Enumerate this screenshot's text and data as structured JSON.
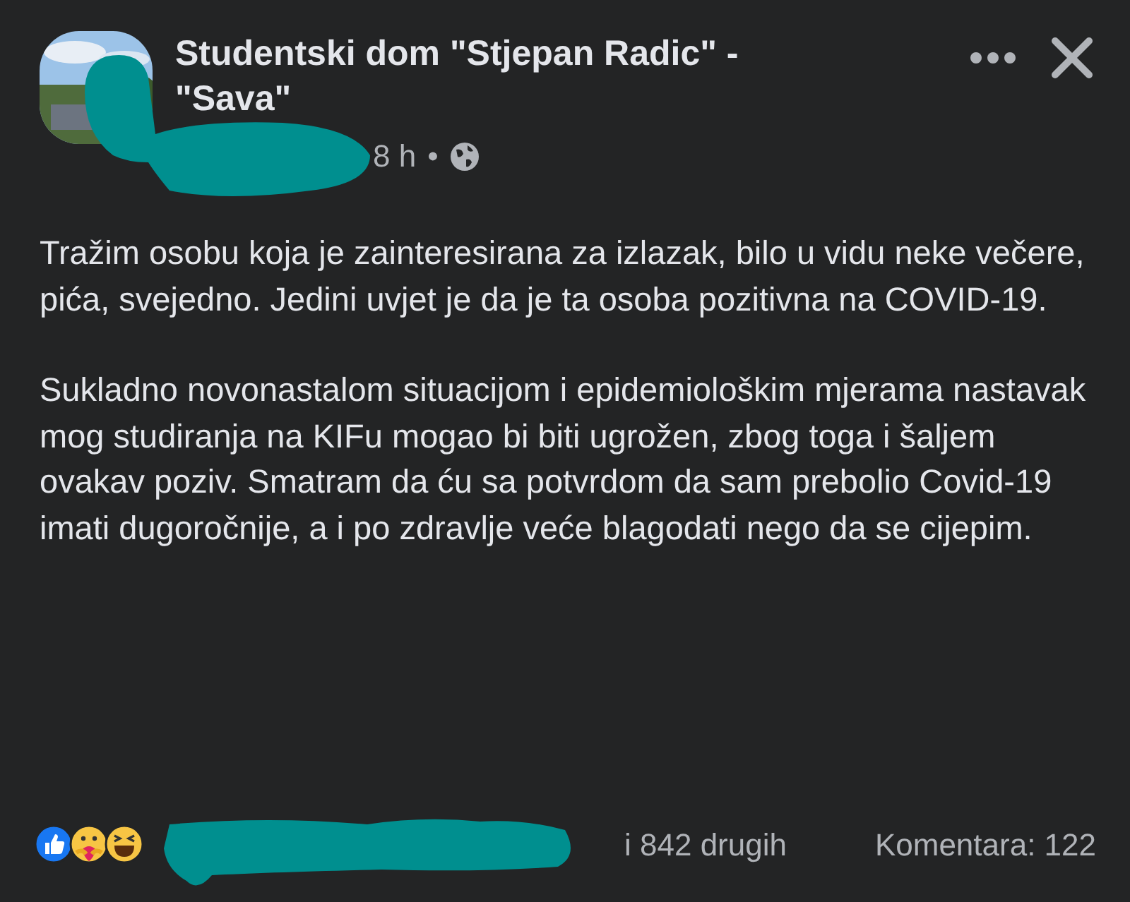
{
  "post": {
    "page_name": "Studentski dom \"Stjepan Radic\" - \"Sava\"",
    "time": "8 h",
    "separator": "•",
    "paragraphs": [
      "Tražim osobu koja je zainteresirana za izlazak, bilo u vidu neke večere, pića, svejedno. Jedini uvjet je da je ta osoba pozitivna na COVID-19.",
      "Sukladno novonastalom situacijom i epidemiološkim mjerama nastavak mog studiranja na KIFu mogao bi biti ugrožen, zbog toga i šaljem ovakav poziv. Smatram da ću sa potvrdom da sam prebolio Covid-19 imati dugoročnije, a i po zdravlje veće blagodati nego da se cijepim."
    ]
  },
  "footer": {
    "reactions": [
      {
        "kind": "like"
      },
      {
        "kind": "care"
      },
      {
        "kind": "haha"
      }
    ],
    "reactions_text": "i 842 drugih",
    "comments": "Komentara: 122"
  }
}
